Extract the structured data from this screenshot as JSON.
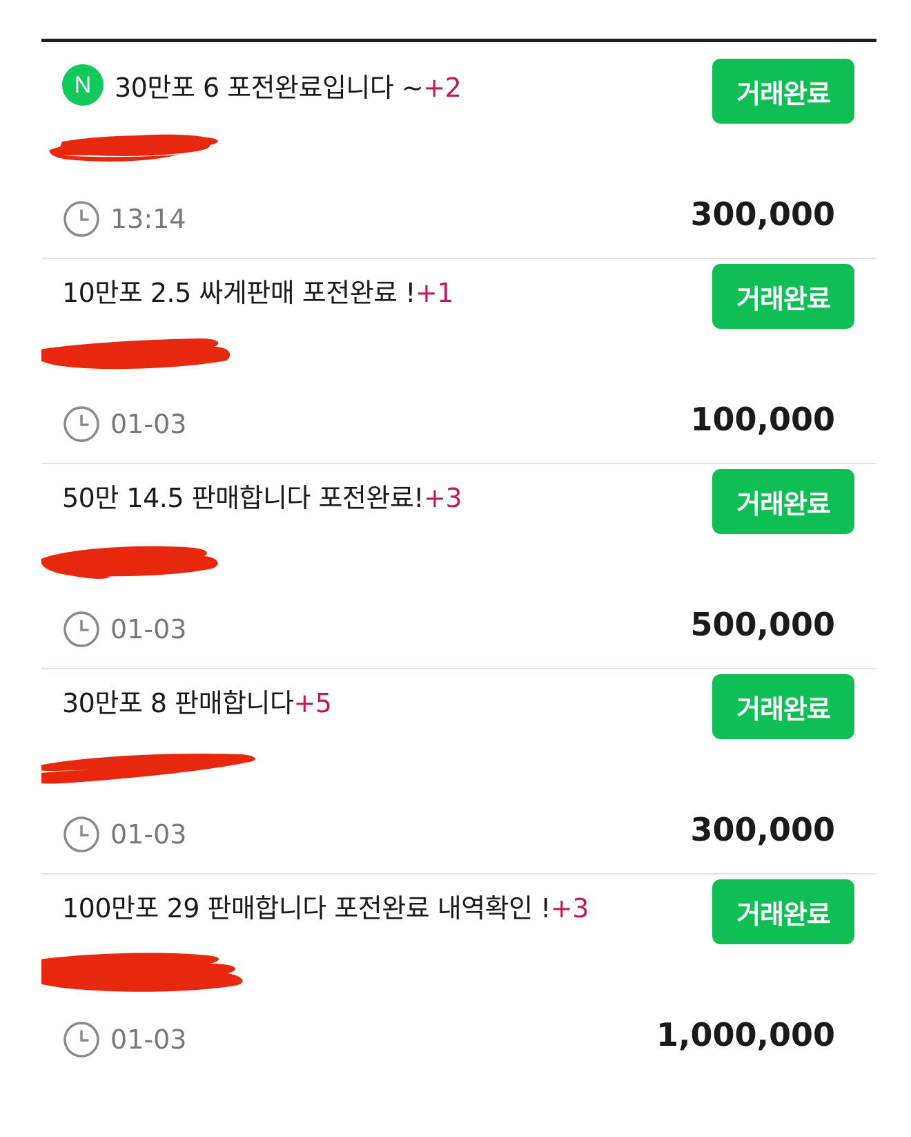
{
  "items": [
    {
      "badge": "N",
      "title": "30만포 6 포전완료입니다 ~",
      "count": "+2",
      "status_label": "거래완료",
      "time": "13:14",
      "price": "300,000"
    },
    {
      "title": "10만포 2.5 싸게판매 포전완료 !",
      "count": "+1",
      "status_label": "거래완료",
      "time": "01-03",
      "price": "100,000"
    },
    {
      "title": "50만 14.5 판매합니다 포전완료!",
      "count": "+3",
      "status_label": "거래완료",
      "time": "01-03",
      "price": "500,000"
    },
    {
      "title": "30만포 8 판매합니다",
      "count": "+5",
      "status_label": "거래완료",
      "time": "01-03",
      "price": "300,000"
    },
    {
      "title": "100만포 29 판매합니다 포전완료 내역확인 !",
      "count": "+3",
      "status_label": "거래완료",
      "time": "01-03",
      "price": "1,000,000"
    }
  ],
  "colors": {
    "button_green": "#0fbf55",
    "badge_green": "#13c95c",
    "comment_count": "#c2185b",
    "redaction": "#e8270f"
  },
  "icons": {
    "new_badge": "new-badge-icon",
    "time": "clock-icon"
  }
}
